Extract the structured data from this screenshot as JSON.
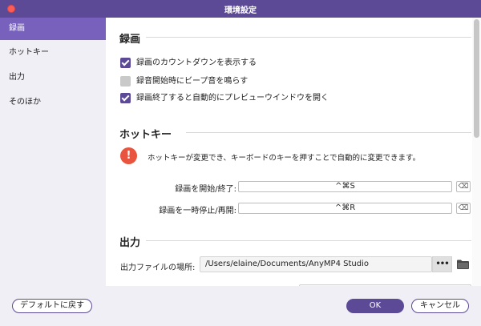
{
  "window": {
    "title": "環境設定"
  },
  "sidebar": {
    "items": [
      {
        "label": "録画",
        "active": true
      },
      {
        "label": "ホットキー",
        "active": false
      },
      {
        "label": "出力",
        "active": false
      },
      {
        "label": "そのほか",
        "active": false
      }
    ]
  },
  "recording": {
    "title": "録画",
    "options": [
      {
        "label": "録画のカウントダウンを表示する",
        "checked": true
      },
      {
        "label": "録音開始時にビープ音を鳴らす",
        "checked": false
      },
      {
        "label": "録画終了すると自動的にプレビューウインドウを開く",
        "checked": true
      }
    ]
  },
  "hotkey": {
    "title": "ホットキー",
    "warning": "ホットキーが変更でき、キーボードのキーを押すことで自動的に変更できます。",
    "rows": [
      {
        "label": "録画を開始/終了:",
        "value": "^⌘S"
      },
      {
        "label": "録画を一時停止/再開:",
        "value": "^⌘R"
      }
    ],
    "clear_glyph": "⌫"
  },
  "output": {
    "title": "出力",
    "file_location_label": "出力ファイルの場所:",
    "file_location_value": "/Users/elaine/Documents/AnyMP4 Studio",
    "browse_label": "•••"
  },
  "footer": {
    "default_label": "デフォルトに戻す",
    "ok_label": "OK",
    "cancel_label": "キャンセル"
  },
  "colors": {
    "accent": "#5d4a97",
    "sidebar_active": "#7761bd",
    "warning": "#e8543d"
  }
}
